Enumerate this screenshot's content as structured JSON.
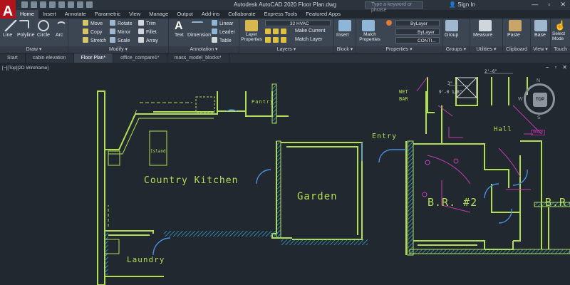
{
  "app": {
    "logo_letter": "A",
    "title": "Autodesk AutoCAD 2020   Floor Plan.dwg"
  },
  "titlebar": {
    "search_placeholder": "Type a keyword or phrase",
    "signin_label": "Sign In",
    "minimize": "—",
    "restore": "▫",
    "close": "✕"
  },
  "ribbon_tabs": [
    "Home",
    "Insert",
    "Annotate",
    "Parametric",
    "View",
    "Manage",
    "Output",
    "Add-ins",
    "Collaborate",
    "Express Tools",
    "Featured Apps"
  ],
  "panels": {
    "draw": {
      "title": "Draw ▾",
      "tools": [
        "Line",
        "Polyline",
        "Circle",
        "Arc"
      ]
    },
    "modify": {
      "title": "Modify ▾",
      "rows": [
        [
          "Move",
          "Rotate",
          "Trim"
        ],
        [
          "Copy",
          "Mirror",
          "Fillet"
        ],
        [
          "Stretch",
          "Scale",
          "Array"
        ]
      ]
    },
    "annotation": {
      "title": "Annotation ▾",
      "text": "Text",
      "dimension": "Dimension",
      "small": [
        "Linear",
        "Leader",
        "Table"
      ]
    },
    "layers": {
      "title": "Layers ▾",
      "layer_props": "Layer Properties",
      "current_layer": "32 HVAC",
      "make_current": "Make Current",
      "match_layer": "Match Layer"
    },
    "block": {
      "title": "Block ▾",
      "insert": "Insert"
    },
    "properties": {
      "title": "Properties ▾",
      "match": "Match Properties",
      "color": "ByLayer",
      "lineweight": "ByLayer",
      "linetype": "CONTI..."
    },
    "groups": {
      "title": "Groups ▾",
      "group": "Group"
    },
    "utilities": {
      "title": "Utilities ▾",
      "measure": "Measure"
    },
    "clipboard": {
      "title": "Clipboard",
      "paste": "Paste"
    },
    "view": {
      "title": "View ▾",
      "base": "Base"
    },
    "touch": {
      "title": "Touch",
      "select_mode": "Select Mode"
    }
  },
  "doc_tabs": [
    "Start",
    "cabin elevation",
    "Floor Plan*",
    "office_compare1*",
    "mass_model_blocks*"
  ],
  "viewport": {
    "label": "[−][Top][2D Wireframe]",
    "controls": [
      "−",
      "▫",
      "✕"
    ],
    "viewcube": "TOP",
    "compass": {
      "n": "N",
      "w": "W",
      "s": "S"
    },
    "wcs": "WCS"
  },
  "rooms": {
    "country_kitchen": "Country Kitchen",
    "pantry": "Pantry",
    "island": "Island",
    "laundry": "Laundry",
    "garden": "Garden",
    "entry": "Entry",
    "br2": "B.R. #2",
    "br_right": "B.R",
    "hall": "Hall",
    "wet_bar_1": "WET",
    "wet_bar_2": "BAR",
    "dim_1": "9'-0 1/8\"",
    "dim_2": "3\"",
    "dim_3": "2'-6\""
  }
}
